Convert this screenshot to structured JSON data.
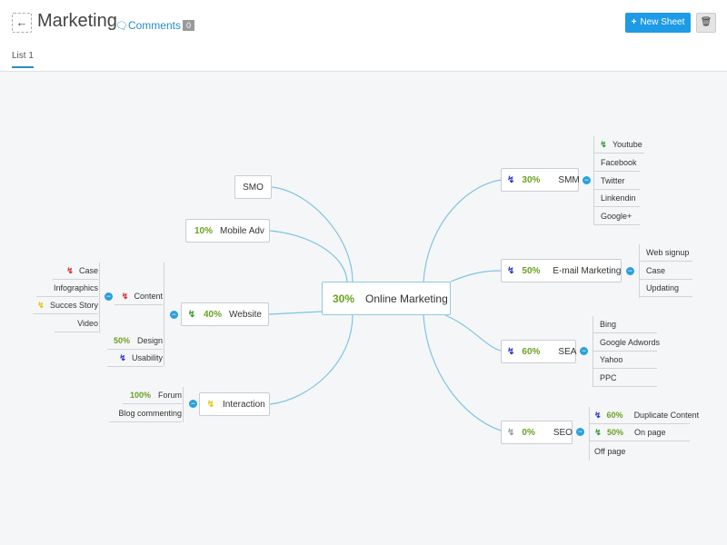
{
  "header": {
    "title": "Marketing",
    "back_icon": "arrow-left-icon",
    "comments_label": "Comments",
    "comments_count": "0",
    "new_sheet_label": "New Sheet",
    "trash_icon": "trash-icon"
  },
  "tabs": [
    {
      "label": "List 1",
      "active": true
    }
  ],
  "colors": {
    "accent": "#1e9be6",
    "line": "#7fc3e4",
    "percent": "#6aa121"
  },
  "map": {
    "root": {
      "percent": "30%",
      "label": "Online Marketing"
    },
    "smo": {
      "label": "SMO"
    },
    "mobile_adv": {
      "percent": "10%",
      "label": "Mobile Adv"
    },
    "website": {
      "percent": "40%",
      "label": "Website",
      "content": {
        "label": "Content",
        "children": [
          {
            "label": "Case"
          },
          {
            "label": "Infographics"
          },
          {
            "label": "Succes Story"
          },
          {
            "label": "Video"
          }
        ]
      },
      "design": {
        "percent": "50%",
        "label": "Design"
      },
      "usability": {
        "label": "Usability"
      }
    },
    "interaction": {
      "label": "Interaction",
      "children": [
        {
          "percent": "100%",
          "label": "Forum"
        },
        {
          "label": "Blog  commenting"
        }
      ]
    },
    "smm": {
      "percent": "30%",
      "label": "SMM",
      "children": [
        {
          "label": "Youtube"
        },
        {
          "label": "Facebook"
        },
        {
          "label": "Twitter"
        },
        {
          "label": "Linkendin"
        },
        {
          "label": "Google+"
        }
      ]
    },
    "email": {
      "percent": "50%",
      "label": "E-mail Marketing",
      "children": [
        {
          "label": "Web signup"
        },
        {
          "label": "Case"
        },
        {
          "label": "Updating"
        }
      ]
    },
    "sea": {
      "percent": "60%",
      "label": "SEA",
      "children": [
        {
          "label": "Bing"
        },
        {
          "label": "Google Adwords"
        },
        {
          "label": "Yahoo"
        },
        {
          "label": "PPC"
        }
      ]
    },
    "seo": {
      "percent": "0%",
      "label": "SEO",
      "children": [
        {
          "percent": "60%",
          "label": "Duplicate Content"
        },
        {
          "percent": "50%",
          "label": "On page"
        },
        {
          "label": "Off page"
        }
      ]
    }
  }
}
